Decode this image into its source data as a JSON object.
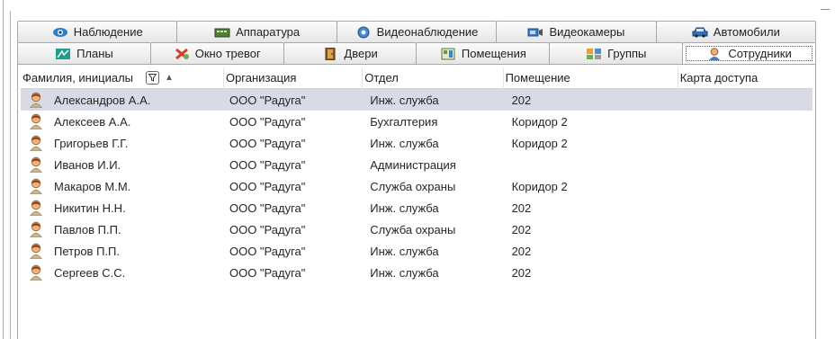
{
  "tabs": {
    "row1": [
      {
        "label": "Наблюдение",
        "icon": "eye-icon"
      },
      {
        "label": "Аппаратура",
        "icon": "hardware-icon"
      },
      {
        "label": "Видеонаблюдение",
        "icon": "video-surveillance-icon"
      },
      {
        "label": "Видеокамеры",
        "icon": "video-camera-icon"
      },
      {
        "label": "Автомобили",
        "icon": "car-icon"
      }
    ],
    "row2": [
      {
        "label": "Планы",
        "icon": "plans-icon"
      },
      {
        "label": "Окно тревог",
        "icon": "alarm-window-icon"
      },
      {
        "label": "Двери",
        "icon": "door-icon"
      },
      {
        "label": "Помещения",
        "icon": "rooms-icon"
      },
      {
        "label": "Группы",
        "icon": "groups-icon"
      },
      {
        "label": "Сотрудники",
        "icon": "employee-icon",
        "active": true
      }
    ]
  },
  "table": {
    "columns": [
      "Фамилия, инициалы",
      "Организация",
      "Отдел",
      "Помещение",
      "Карта доступа"
    ],
    "filter_icon": "filter-icon",
    "sort_icon": "sort-ascending-icon",
    "rows": [
      {
        "name": "Александров А.А.",
        "org": "ООО \"Радуга\"",
        "dept": "Инж. служба",
        "room": "202",
        "card": "",
        "selected": true
      },
      {
        "name": "Алексеев А.А.",
        "org": "ООО \"Радуга\"",
        "dept": "Бухгалтерия",
        "room": "Коридор 2",
        "card": ""
      },
      {
        "name": "Григорьев Г.Г.",
        "org": "ООО \"Радуга\"",
        "dept": "Инж. служба",
        "room": "Коридор 2",
        "card": ""
      },
      {
        "name": "Иванов И.И.",
        "org": "ООО \"Радуга\"",
        "dept": "Администрация",
        "room": "",
        "card": ""
      },
      {
        "name": "Макаров М.М.",
        "org": "ООО \"Радуга\"",
        "dept": "Служба охраны",
        "room": "Коридор 2",
        "card": ""
      },
      {
        "name": "Никитин Н.Н.",
        "org": "ООО \"Радуга\"",
        "dept": "Инж. служба",
        "room": "202",
        "card": ""
      },
      {
        "name": "Павлов П.П.",
        "org": "ООО \"Радуга\"",
        "dept": "Служба охраны",
        "room": "202",
        "card": ""
      },
      {
        "name": "Петров П.П.",
        "org": "ООО \"Радуга\"",
        "dept": "Инж. служба",
        "room": "202",
        "card": ""
      },
      {
        "name": "Сергеев С.С.",
        "org": "ООО \"Радуга\"",
        "dept": "Инж. служба",
        "room": "202",
        "card": ""
      }
    ]
  },
  "colors": {
    "selected_row": "#d8dbe6",
    "tab_border": "#a8a8a8"
  }
}
